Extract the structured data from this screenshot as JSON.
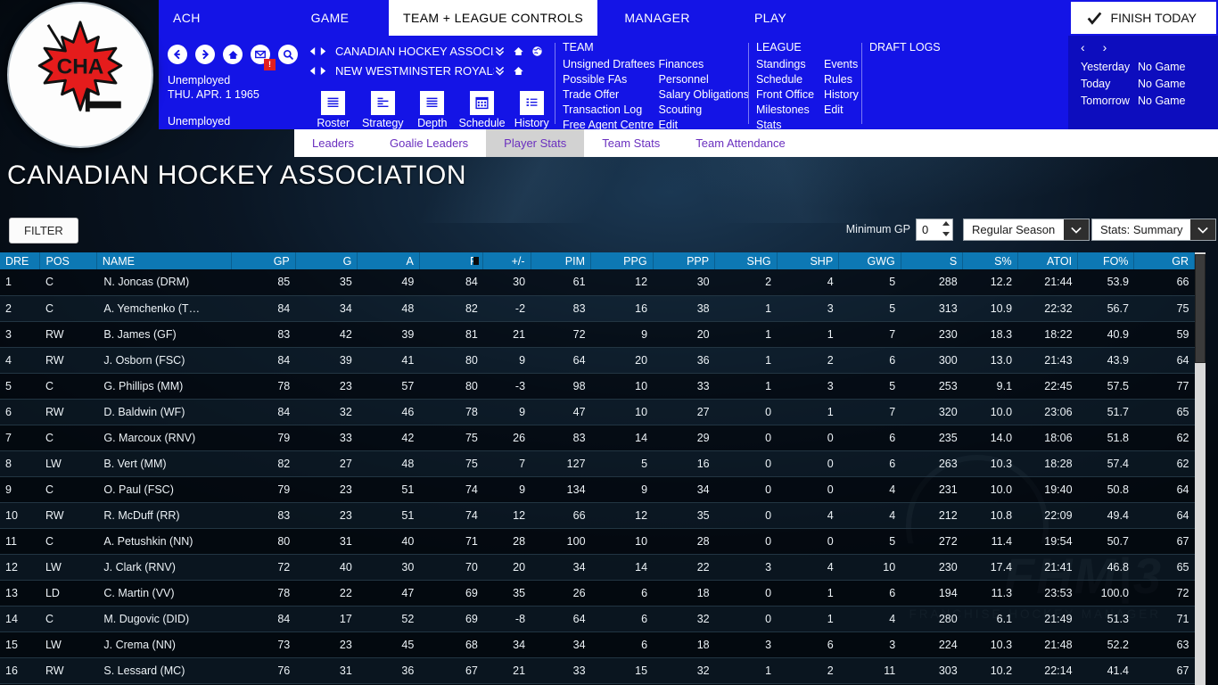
{
  "window": {
    "title": "Franchise Hockey Manager 3"
  },
  "logo": {
    "team_abbrev": "CHA",
    "alt": "Canadian Hockey Association crest"
  },
  "menubar": {
    "items": [
      {
        "label": "ACH",
        "active": false
      },
      {
        "label": "GAME",
        "active": false
      },
      {
        "label": "TEAM + LEAGUE CONTROLS",
        "active": true
      },
      {
        "label": "MANAGER",
        "active": false
      },
      {
        "label": "PLAY",
        "active": false
      }
    ],
    "finish_today": "FINISH TODAY"
  },
  "nav": {
    "icons": [
      "back-icon",
      "forward-icon",
      "home-icon",
      "mail-icon",
      "search-icon"
    ],
    "mail_badge": "!",
    "status_line1": "Unemployed",
    "date_line": "THU. APR. 1 1965",
    "status_line2": "Unemployed"
  },
  "selector": {
    "league": "CANADIAN HOCKEY ASSOCIATI",
    "team": "NEW WESTMINSTER ROYALS"
  },
  "shortcuts": [
    {
      "label": "Roster",
      "icon": "roster-icon"
    },
    {
      "label": "Strategy",
      "icon": "strategy-icon"
    },
    {
      "label": "Depth",
      "icon": "depth-icon"
    },
    {
      "label": "Schedule",
      "icon": "schedule-icon"
    },
    {
      "label": "History",
      "icon": "history-icon"
    }
  ],
  "groups": {
    "team": {
      "title": "TEAM",
      "col1": [
        "Unsigned Draftees",
        "Possible FAs",
        "Trade Offer",
        "Transaction Log",
        "Free Agent Centre"
      ],
      "col2": [
        "Finances",
        "Personnel",
        "Salary Obligations",
        "Scouting",
        "Edit"
      ]
    },
    "league": {
      "title": "LEAGUE",
      "col1": [
        "Standings",
        "Schedule",
        "Front Office",
        "Milestones",
        "Stats"
      ],
      "col2": [
        "Events",
        "Rules",
        "History",
        "Edit"
      ]
    },
    "draft": {
      "title": "DRAFT LOGS",
      "col1": [],
      "col2": []
    }
  },
  "schedule": {
    "prev": "‹",
    "next": "›",
    "rows": [
      {
        "day": "Yesterday",
        "value": "No Game"
      },
      {
        "day": "Today",
        "value": "No Game"
      },
      {
        "day": "Tomorrow",
        "value": "No Game"
      }
    ]
  },
  "subtabs": [
    {
      "label": "Leaders",
      "active": false
    },
    {
      "label": "Goalie Leaders",
      "active": false
    },
    {
      "label": "Player Stats",
      "active": true
    },
    {
      "label": "Team Stats",
      "active": false
    },
    {
      "label": "Team Attendance",
      "active": false
    }
  ],
  "page_title": "CANADIAN HOCKEY ASSOCIATION",
  "filterbar": {
    "filter_button": "FILTER",
    "minimum_gp_label": "Minimum GP",
    "minimum_gp_value": "0",
    "season_select": "Regular Season",
    "stats_select": "Stats: Summary"
  },
  "colors": {
    "menu_blue": "#1414e6",
    "panel_blue": "#0d0dbe",
    "header_blue": "#0d78b4",
    "tab_active_bg": "#d2d2d2",
    "tab_text": "#6a2fbf",
    "badge_red": "#e21f1f",
    "crest_red": "#e51c1c"
  },
  "table": {
    "sorted_column": "P",
    "columns": [
      {
        "key": "DRE",
        "label": "DRE",
        "align": "l"
      },
      {
        "key": "POS",
        "label": "POS",
        "align": "l"
      },
      {
        "key": "NAME",
        "label": "NAME",
        "align": "l"
      },
      {
        "key": "GP",
        "label": "GP",
        "align": "r"
      },
      {
        "key": "G",
        "label": "G",
        "align": "r"
      },
      {
        "key": "A",
        "label": "A",
        "align": "r"
      },
      {
        "key": "P",
        "label": "P",
        "align": "r"
      },
      {
        "key": "PM",
        "label": "+/-",
        "align": "r"
      },
      {
        "key": "PIM",
        "label": "PIM",
        "align": "r"
      },
      {
        "key": "PPG",
        "label": "PPG",
        "align": "r"
      },
      {
        "key": "PPP",
        "label": "PPP",
        "align": "r"
      },
      {
        "key": "SHG",
        "label": "SHG",
        "align": "r"
      },
      {
        "key": "SHP",
        "label": "SHP",
        "align": "r"
      },
      {
        "key": "GWG",
        "label": "GWG",
        "align": "r"
      },
      {
        "key": "S",
        "label": "S",
        "align": "r"
      },
      {
        "key": "SPCT",
        "label": "S%",
        "align": "r"
      },
      {
        "key": "ATOI",
        "label": "ATOI",
        "align": "r"
      },
      {
        "key": "FOPCT",
        "label": "FO%",
        "align": "r"
      },
      {
        "key": "GR",
        "label": "GR",
        "align": "r"
      }
    ],
    "rows": [
      [
        "1",
        "C",
        "N. Joncas (DRM)",
        "85",
        "35",
        "49",
        "84",
        "30",
        "61",
        "12",
        "30",
        "2",
        "4",
        "5",
        "288",
        "12.2",
        "21:44",
        "53.9",
        "66"
      ],
      [
        "2",
        "C",
        "A. Yemchenko (T…",
        "84",
        "34",
        "48",
        "82",
        "-2",
        "83",
        "16",
        "38",
        "1",
        "3",
        "5",
        "313",
        "10.9",
        "22:32",
        "56.7",
        "75"
      ],
      [
        "3",
        "RW",
        "B. James (GF)",
        "83",
        "42",
        "39",
        "81",
        "21",
        "72",
        "9",
        "20",
        "1",
        "1",
        "7",
        "230",
        "18.3",
        "18:22",
        "40.9",
        "59"
      ],
      [
        "4",
        "RW",
        "J. Osborn (FSC)",
        "84",
        "39",
        "41",
        "80",
        "9",
        "64",
        "20",
        "36",
        "1",
        "2",
        "6",
        "300",
        "13.0",
        "21:43",
        "43.9",
        "64"
      ],
      [
        "5",
        "C",
        "G. Phillips (MM)",
        "78",
        "23",
        "57",
        "80",
        "-3",
        "98",
        "10",
        "33",
        "1",
        "3",
        "5",
        "253",
        "9.1",
        "22:45",
        "57.5",
        "77"
      ],
      [
        "6",
        "RW",
        "D. Baldwin (WF)",
        "84",
        "32",
        "46",
        "78",
        "9",
        "47",
        "10",
        "27",
        "0",
        "1",
        "7",
        "320",
        "10.0",
        "23:06",
        "51.7",
        "65"
      ],
      [
        "7",
        "C",
        "G. Marcoux (RNV)",
        "79",
        "33",
        "42",
        "75",
        "26",
        "83",
        "14",
        "29",
        "0",
        "0",
        "6",
        "235",
        "14.0",
        "18:06",
        "51.8",
        "62"
      ],
      [
        "8",
        "LW",
        "B. Vert (MM)",
        "82",
        "27",
        "48",
        "75",
        "7",
        "127",
        "5",
        "16",
        "0",
        "0",
        "6",
        "263",
        "10.3",
        "18:28",
        "57.4",
        "62"
      ],
      [
        "9",
        "C",
        "O. Paul (FSC)",
        "79",
        "23",
        "51",
        "74",
        "9",
        "134",
        "9",
        "34",
        "0",
        "0",
        "4",
        "231",
        "10.0",
        "19:40",
        "50.8",
        "64"
      ],
      [
        "10",
        "RW",
        "R. McDuff (RR)",
        "83",
        "23",
        "51",
        "74",
        "12",
        "66",
        "12",
        "35",
        "0",
        "4",
        "4",
        "212",
        "10.8",
        "22:09",
        "49.4",
        "64"
      ],
      [
        "11",
        "C",
        "A. Petushkin (NN)",
        "80",
        "31",
        "40",
        "71",
        "28",
        "100",
        "10",
        "28",
        "0",
        "0",
        "5",
        "272",
        "11.4",
        "19:54",
        "50.7",
        "67"
      ],
      [
        "12",
        "LW",
        "J. Clark (RNV)",
        "72",
        "40",
        "30",
        "70",
        "20",
        "34",
        "14",
        "22",
        "3",
        "4",
        "10",
        "230",
        "17.4",
        "21:41",
        "46.8",
        "65"
      ],
      [
        "13",
        "LD",
        "C. Martin (VV)",
        "78",
        "22",
        "47",
        "69",
        "35",
        "26",
        "6",
        "18",
        "0",
        "1",
        "6",
        "194",
        "11.3",
        "23:53",
        "100.0",
        "72"
      ],
      [
        "14",
        "C",
        "M. Dugovic (DID)",
        "84",
        "17",
        "52",
        "69",
        "-8",
        "64",
        "6",
        "32",
        "0",
        "1",
        "4",
        "280",
        "6.1",
        "21:49",
        "51.3",
        "71"
      ],
      [
        "15",
        "LW",
        "J. Crema (NN)",
        "73",
        "23",
        "45",
        "68",
        "34",
        "34",
        "6",
        "18",
        "3",
        "6",
        "3",
        "224",
        "10.3",
        "21:48",
        "52.2",
        "63"
      ],
      [
        "16",
        "RW",
        "S. Lessard (MC)",
        "76",
        "31",
        "36",
        "67",
        "21",
        "33",
        "15",
        "32",
        "1",
        "2",
        "11",
        "303",
        "10.2",
        "22:14",
        "41.4",
        "67"
      ]
    ]
  },
  "watermark": {
    "text": "FHM|3",
    "subtitle": "FRANCHISE HOCKEY MANAGER"
  }
}
